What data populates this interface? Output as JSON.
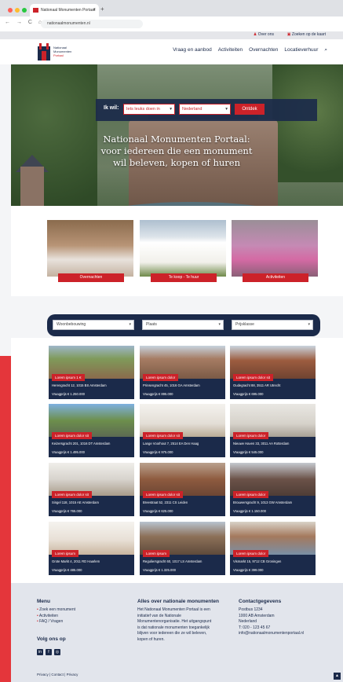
{
  "browser": {
    "tab_title": "Nationaal Monumenten Portaal",
    "url": "nationaalmonumenten.nl",
    "close_glyph": "×",
    "new_tab_glyph": "+",
    "nav_glyphs": "← → C ⌂"
  },
  "utility_bar": {
    "about": "Over ons",
    "mortgage": "Zoeken op de kaart"
  },
  "header": {
    "logo_text_line1": "Nationaal",
    "logo_text_line2": "Monumenten",
    "logo_text_line3": "Portaal",
    "nav": [
      "Vraag en aanbod",
      "Activiteiten",
      "Overnachten",
      "Locatieverhuur"
    ],
    "search_icon": "⌕"
  },
  "hero": {
    "search_label": "Ik wil:",
    "select1": "Iets leuks doen in",
    "select2": "Nederland",
    "button": "Ontdek",
    "title_line1": "Nationaal Monumenten Portaal:",
    "title_line2": "voor iedereen die een monument",
    "title_line3": "wil beleven, kopen of huren"
  },
  "categories": [
    {
      "label": "Overnachten"
    },
    {
      "label": "Te koop - Te huur"
    },
    {
      "label": "Activiteiten"
    }
  ],
  "filters": {
    "f1": "Woonbebouwing",
    "f2": "Plaats",
    "f3": "Prijsklasse",
    "caret": "▾"
  },
  "listings": [
    {
      "badge": "Lorem ipsum 1 €",
      "addr": "Herengracht 12, 1015 BS Amsterdam",
      "price": "Vraagprijs € 1.250.000"
    },
    {
      "badge": "Lorem ipsum dolor",
      "addr": "Prinsengracht 45, 1016 GA Amsterdam",
      "price": "Vraagprijs € 895.000"
    },
    {
      "badge": "Lorem ipsum dolor sit",
      "addr": "Oudegracht 88, 3511 AR Utrecht",
      "price": "Vraagprijs € 695.000"
    },
    {
      "badge": "Lorem ipsum dolor sit",
      "addr": "Keizersgracht 201, 1016 DT Amsterdam",
      "price": "Vraagprijs € 1.495.000"
    },
    {
      "badge": "Lorem ipsum dolor sit",
      "addr": "Lange Voorhout 7, 2514 EA Den Haag",
      "price": "Vraagprijs € 975.000"
    },
    {
      "badge": "Lorem ipsum dolor",
      "addr": "Nieuwe Haven 33, 3011 AA Rotterdam",
      "price": "Vraagprijs € 545.000"
    },
    {
      "badge": "Lorem ipsum dolor sit",
      "addr": "Singel 118, 1015 AE Amsterdam",
      "price": "Vraagprijs € 765.000"
    },
    {
      "badge": "Lorem ipsum dolor sit",
      "addr": "Breestraat 52, 2311 CS Leiden",
      "price": "Vraagprijs € 625.000"
    },
    {
      "badge": "Lorem ipsum dolor",
      "addr": "Brouwersgracht 9, 1013 GW Amsterdam",
      "price": "Vraagprijs € 1.150.000"
    },
    {
      "badge": "Lorem ipsum",
      "addr": "Grote Markt 4, 2011 RD Haarlem",
      "price": "Vraagprijs € 485.000"
    },
    {
      "badge": "Lorem ipsum",
      "addr": "Reguliersgracht 60, 1017 LS Amsterdam",
      "price": "Vraagprijs € 1.325.000"
    },
    {
      "badge": "Lorem ipsum dolor",
      "addr": "Vismarkt 15, 9712 CB Groningen",
      "price": "Vraagprijs € 399.000"
    }
  ],
  "footer": {
    "menu_title": "Menu",
    "menu": [
      "Zoek een monument",
      "Activiteiten",
      "FAQ / Vragen"
    ],
    "follow_title": "Volg ons op",
    "social": [
      "in",
      "f",
      "◎"
    ],
    "about_title": "Alles over nationale monumenten",
    "about_text": [
      "Het Nationaal Monumenten Portaal is een",
      "initiatief van de Nationale",
      "Monumentenorganisatie. Het uitgangspunt",
      "is dat nationale monumenten toegankelijk",
      "blijven voor iedereen die ze wil beleven,",
      "kopen of huren."
    ],
    "contact_title": "Contactgegevens",
    "contact_text": [
      "Postbus 1234",
      "1000 AB Amsterdam",
      "Nederland",
      "T: 020 - 123 45 67",
      "info@nationaalmonumentenportaal.nl"
    ],
    "copyright": "Privacy | Contact | Privacy",
    "to_top": "▲"
  },
  "colors": {
    "navy": "#1b2a4a",
    "red": "#cc2229"
  }
}
